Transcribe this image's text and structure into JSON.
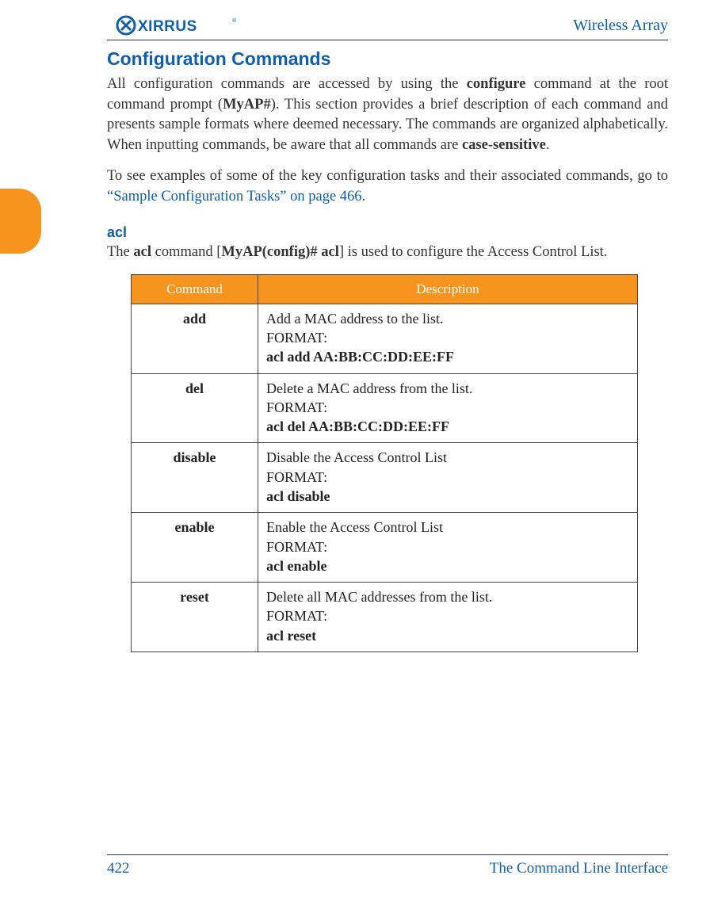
{
  "header": {
    "product_name": "Wireless Array"
  },
  "section": {
    "heading": "Configuration Commands",
    "intro_html": "All configuration commands are accessed by using the <span class=\"b\">configure</span> command at the root command prompt (<span class=\"b\">MyAP#</span>). This section provides a brief description of each command and presents sample formats where deemed necessary. The commands are organized alphabetically. When inputting commands, be aware that all commands are <span class=\"b\">case-sensitive</span>.",
    "para2_prefix": "To see examples of some of the key configuration tasks and their associated commands, go to ",
    "para2_link": "“Sample Configuration Tasks” on page 466",
    "para2_suffix": "."
  },
  "subsection": {
    "heading": "acl",
    "text_html": "The <span class=\"b\">acl</span> command [<span class=\"b\">MyAP(config)# acl</span>] is used to configure the Access Control List."
  },
  "table": {
    "headers": {
      "command": "Command",
      "description": "Description"
    }
  },
  "chart_data": {
    "type": "table",
    "headers": [
      "Command",
      "Description"
    ],
    "rows": [
      {
        "command": "add",
        "description": "Add a MAC address to the list.",
        "format_label": "FORMAT:",
        "format": "acl add AA:BB:CC:DD:EE:FF"
      },
      {
        "command": "del",
        "description": "Delete a MAC address from the list.",
        "format_label": "FORMAT:",
        "format": "acl del AA:BB:CC:DD:EE:FF"
      },
      {
        "command": "disable",
        "description": "Disable the Access Control List",
        "format_label": "FORMAT:",
        "format": "acl disable"
      },
      {
        "command": "enable",
        "description": "Enable the Access Control List",
        "format_label": "FORMAT:",
        "format": "acl enable"
      },
      {
        "command": "reset",
        "description": "Delete all MAC addresses from the list.",
        "format_label": "FORMAT:",
        "format": "acl reset"
      }
    ]
  },
  "footer": {
    "page_number": "422",
    "chapter": "The Command Line Interface"
  }
}
